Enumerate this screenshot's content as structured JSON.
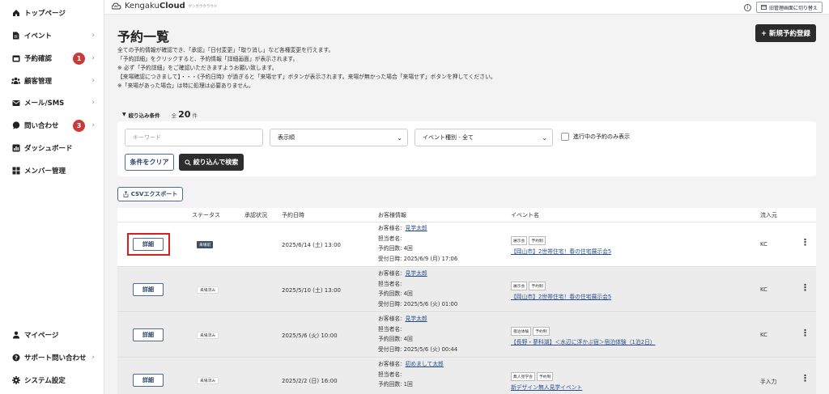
{
  "sidebar": {
    "items": [
      {
        "label": "トップページ",
        "icon": "home-icon",
        "chevron": false
      },
      {
        "label": "イベント",
        "icon": "document-icon",
        "chevron": true
      },
      {
        "label": "予約確認",
        "icon": "calendar-icon",
        "chevron": true,
        "badge": "1"
      },
      {
        "label": "顧客管理",
        "icon": "users-icon",
        "chevron": true
      },
      {
        "label": "メール/SMS",
        "icon": "mail-icon",
        "chevron": true
      },
      {
        "label": "問い合わせ",
        "icon": "chat-icon",
        "chevron": true,
        "badge": "3"
      },
      {
        "label": "ダッシュボード",
        "icon": "chart-icon",
        "chevron": false
      },
      {
        "label": "メンバー管理",
        "icon": "grid-icon",
        "chevron": false
      }
    ],
    "bottom": [
      {
        "label": "マイページ",
        "icon": "person-icon",
        "chevron": false
      },
      {
        "label": "サポート問い合わせ",
        "icon": "help-icon",
        "chevron": true
      },
      {
        "label": "システム設定",
        "icon": "gear-icon",
        "chevron": false
      }
    ]
  },
  "topbar": {
    "logo_prefix": "Kengaku",
    "logo_bold": "Cloud",
    "logo_sub": "ケンガククラウド",
    "info": "i",
    "switch_label": "旧管理画面に切り替え"
  },
  "page": {
    "title": "予約一覧",
    "new_button": "+ 新規予約登録",
    "description": [
      "全ての予約情報が確認でき、「承認」「日付変更」「取り消し」など各種変更を行えます。",
      "「予約詳細」をクリックすると、予約情報「詳細画面」が表示されます。",
      "※ 必ず「予約詳細」をご確認いただきますようお願い致します。",
      "【来場確認につきまして】・・・《予約日時》が過ぎると「来場せず」ボタンが表示されます。来場が無かった場合「来場せず」ボタンを押してください。",
      "※「来場があった場合」は特に処理は必要ありません。"
    ]
  },
  "filter": {
    "toggle_label": "絞り込み条件",
    "all_prefix": "全",
    "count": "20",
    "count_unit": "件",
    "keyword_placeholder": "キーワード",
    "sort_value": "表示順",
    "event_type_value": "イベント種別 - 全て",
    "in_progress_label": "進行中の予約のみ表示",
    "clear_label": "条件をクリア",
    "search_label": "絞り込んで検索"
  },
  "csv_label": "CSVエクスポート",
  "table": {
    "headers": [
      "ステータス",
      "承認状況",
      "予約日時",
      "お客様情報",
      "イベント名",
      "流入元"
    ],
    "rows": [
      {
        "detail": "詳細",
        "status": "来場前",
        "status_style": "dark",
        "date": "2025/6/14 (土) 13:00",
        "cust_label": "お客様名:",
        "customer": "見学太郎",
        "staff": "担当者名:",
        "count": "予約回数: 4回",
        "received": "受付日時: 2025/6/9 (月) 17:06",
        "tags": [
          "展示会",
          "予約制"
        ],
        "event": "【岡山市】2世帯住宅！春の住宅展示会5",
        "source": "KC",
        "highlight": true
      },
      {
        "detail": "詳細",
        "status": "来場済み",
        "status_style": "light",
        "date": "2025/5/10 (土) 13:00",
        "cust_label": "お客様名:",
        "customer": "見学太郎",
        "staff": "担当者名:",
        "count": "予約回数: 4回",
        "received": "受付日時: 2025/5/6 (火) 01:00",
        "tags": [
          "展示会",
          "予約制"
        ],
        "event": "【岡山市】2世帯住宅！春の住宅展示会5",
        "source": "KC",
        "highlight": false
      },
      {
        "detail": "詳細",
        "status": "来場済み",
        "status_style": "light",
        "date": "2025/5/6 (火) 10:00",
        "cust_label": "お客様名:",
        "customer": "見学太郎",
        "staff": "担当者名:",
        "count": "予約回数: 4回",
        "received": "受付日時: 2025/5/6 (火) 00:44",
        "tags": [
          "宿泊体験",
          "予約制"
        ],
        "event": "【長野・蓼科湖】＜水辺に浮かぶ宿＞宿泊体験（1泊2日）",
        "source": "KC",
        "highlight": false
      },
      {
        "detail": "詳細",
        "status": "来場済み",
        "status_style": "light",
        "date": "2025/2/2 (日) 16:00",
        "cust_label": "お客様名:",
        "customer": "初めまして太郎",
        "staff": "担当者名:",
        "count": "予約回数: 1回",
        "received": "",
        "tags": [
          "無人見学会",
          "予約制"
        ],
        "event": "新デザイン無人見学イベント",
        "source": "手入力",
        "highlight": false
      }
    ]
  },
  "colors": {
    "accent_dark": "#2d2d2d",
    "badge_red": "#c93a3a",
    "link_blue": "#2a4e8c",
    "highlight_red": "#d81e1e"
  }
}
